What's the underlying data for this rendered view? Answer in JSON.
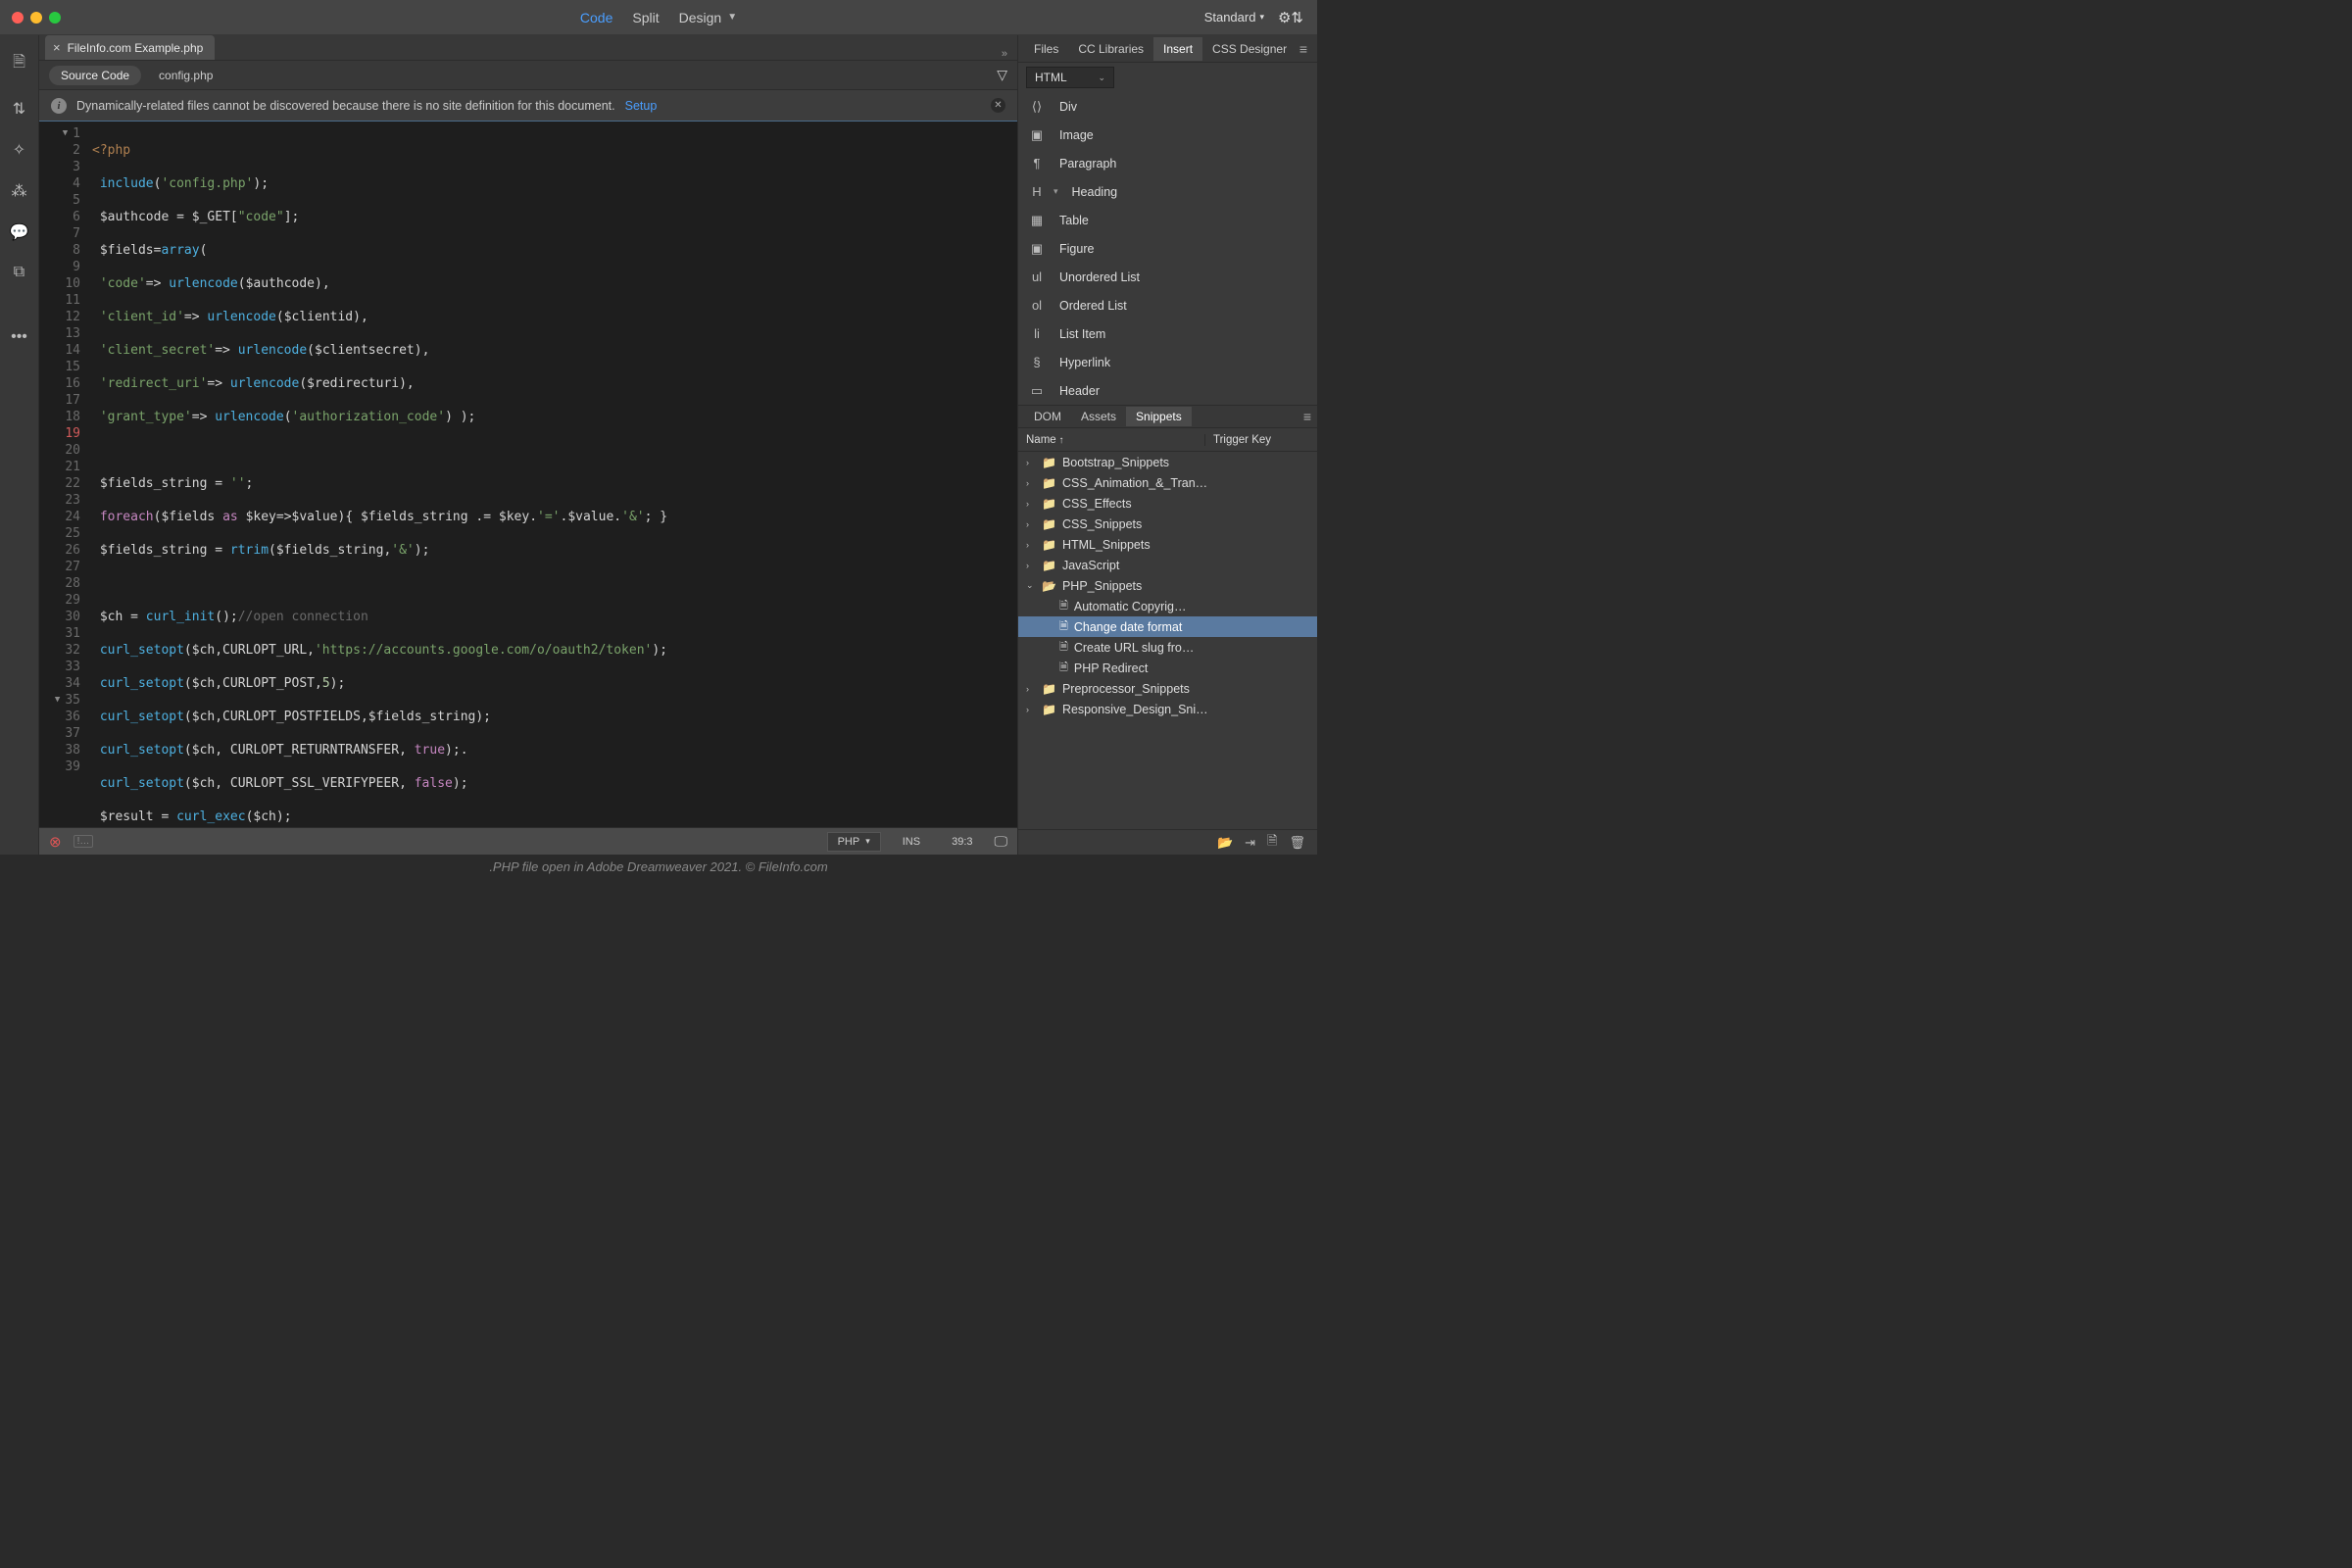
{
  "titlebar": {
    "views": [
      "Code",
      "Split",
      "Design"
    ],
    "active_view": "Code",
    "workspace_label": "Standard"
  },
  "file_tab": "FileInfo.com Example.php",
  "source_tabs": {
    "active": "Source Code",
    "other": "config.php"
  },
  "info_bar": {
    "message": "Dynamically-related files cannot be discovered because there is no site definition for this document.",
    "link": "Setup"
  },
  "code": {
    "line_numbers": [
      1,
      2,
      3,
      4,
      5,
      6,
      7,
      8,
      9,
      10,
      11,
      12,
      13,
      14,
      15,
      16,
      17,
      18,
      19,
      20,
      21,
      22,
      23,
      24,
      25,
      26,
      27,
      28,
      29,
      30,
      31,
      32,
      33,
      34,
      35,
      36,
      37,
      38,
      39
    ],
    "red_lines": [
      19
    ]
  },
  "status": {
    "hidden": "!…",
    "lang": "PHP",
    "mode": "INS",
    "cursor": "39:3"
  },
  "right_panel": {
    "top_tabs": [
      "Files",
      "CC Libraries",
      "Insert",
      "CSS Designer"
    ],
    "top_active": "Insert",
    "dropdown": "HTML",
    "insert_items": [
      {
        "icon": "⟨⟩",
        "label": "Div"
      },
      {
        "icon": "▣",
        "label": "Image"
      },
      {
        "icon": "¶",
        "label": "Paragraph"
      },
      {
        "icon": "H",
        "label": "Heading",
        "sub": true
      },
      {
        "icon": "▦",
        "label": "Table"
      },
      {
        "icon": "▣",
        "label": "Figure"
      },
      {
        "icon": "ul",
        "label": "Unordered List"
      },
      {
        "icon": "ol",
        "label": "Ordered List"
      },
      {
        "icon": "li",
        "label": "List Item"
      },
      {
        "icon": "§",
        "label": "Hyperlink"
      },
      {
        "icon": "▭",
        "label": "Header"
      }
    ],
    "bottom_tabs": [
      "DOM",
      "Assets",
      "Snippets"
    ],
    "bottom_active": "Snippets",
    "snip_header": {
      "name": "Name",
      "trigger": "Trigger Key"
    },
    "snippets": [
      {
        "type": "folder",
        "open": false,
        "label": "Bootstrap_Snippets"
      },
      {
        "type": "folder",
        "open": false,
        "label": "CSS_Animation_&_Tran…"
      },
      {
        "type": "folder",
        "open": false,
        "label": "CSS_Effects"
      },
      {
        "type": "folder",
        "open": false,
        "label": "CSS_Snippets"
      },
      {
        "type": "folder",
        "open": false,
        "label": "HTML_Snippets"
      },
      {
        "type": "folder",
        "open": false,
        "label": "JavaScript"
      },
      {
        "type": "folder",
        "open": true,
        "label": "PHP_Snippets"
      },
      {
        "type": "file",
        "label": "Automatic Copyrig…"
      },
      {
        "type": "file",
        "label": "Change date format",
        "selected": true
      },
      {
        "type": "file",
        "label": "Create URL slug fro…"
      },
      {
        "type": "file",
        "label": "PHP Redirect"
      },
      {
        "type": "folder",
        "open": false,
        "label": "Preprocessor_Snippets"
      },
      {
        "type": "folder",
        "open": false,
        "label": "Responsive_Design_Sni…"
      }
    ]
  },
  "footer": ".PHP file open in Adobe Dreamweaver 2021. © FileInfo.com"
}
